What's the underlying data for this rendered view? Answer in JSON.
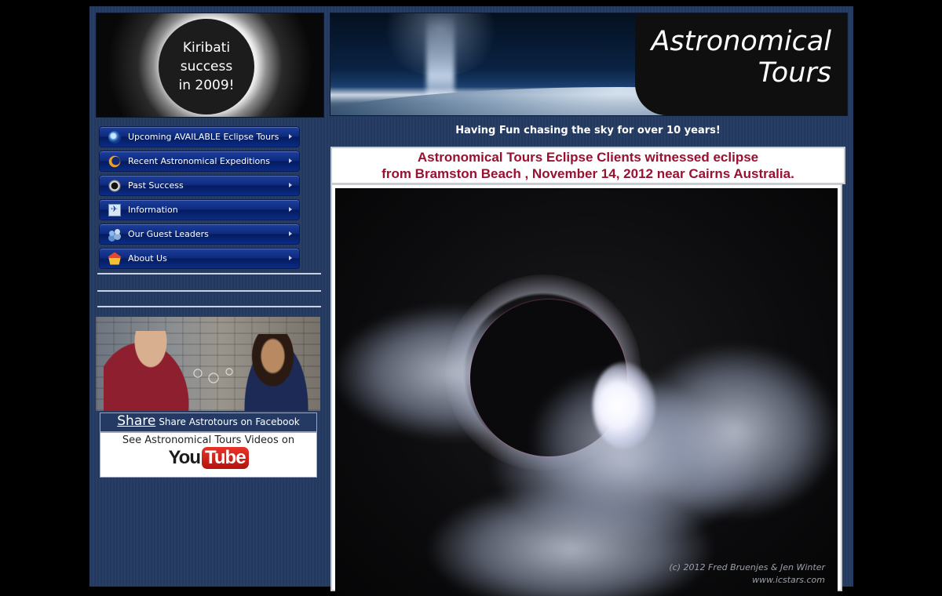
{
  "promo": {
    "text": "Kiribati\nsuccess\nin 2009!"
  },
  "nav": {
    "items": [
      {
        "label": "Upcoming AVAILABLE Eclipse Tours",
        "icon": "globe-icon"
      },
      {
        "label": "Recent Astronomical Expeditions",
        "icon": "moon-icon"
      },
      {
        "label": "Past Success",
        "icon": "eclipse-icon"
      },
      {
        "label": "Information",
        "icon": "plane-icon"
      },
      {
        "label": "Our Guest Leaders",
        "icon": "people-icon"
      },
      {
        "label": "About Us",
        "icon": "house-icon"
      }
    ]
  },
  "share": {
    "big": "Share",
    "small": "Share Astrotours on Facebook"
  },
  "youtube": {
    "caption": "See Astronomical Tours Videos on",
    "you": "You",
    "tube": "Tube"
  },
  "banner": {
    "title": "Astronomical\nTours"
  },
  "tagline": "Having Fun chasing the sky for over 10 years!",
  "headline": {
    "line1": "Astronomical Tours Eclipse Clients witnessed eclipse",
    "line2": "from Bramston Beach , November 14, 2012 near Cairns Australia."
  },
  "eclipse_photo": {
    "credit": "(c) 2012 Fred Bruenjes & Jen Winter\nwww.icstars.com"
  },
  "colors": {
    "page_bg": "#24395f",
    "headline_red": "#9a1030",
    "nav_blue": "#0d2a7c"
  }
}
